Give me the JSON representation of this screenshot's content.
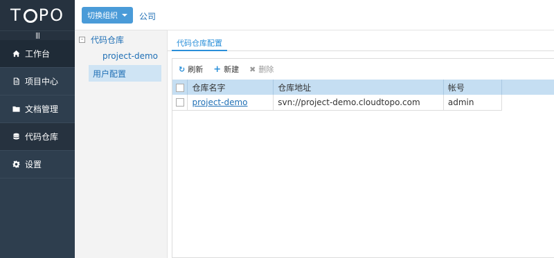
{
  "app": {
    "logo_text_left": "T",
    "logo_text_right": "PO",
    "collapse_icon": "|||"
  },
  "sidebar": {
    "items": [
      {
        "label": "工作台",
        "icon": "home-icon"
      },
      {
        "label": "项目中心",
        "icon": "document-icon"
      },
      {
        "label": "文档管理",
        "icon": "folder-icon"
      },
      {
        "label": "代码仓库",
        "icon": "database-icon"
      },
      {
        "label": "设置",
        "icon": "gear-icon"
      }
    ]
  },
  "header": {
    "switch_org_label": "切换组织",
    "company_label": "公司"
  },
  "tree": {
    "root_label": "代码仓库",
    "root_toggle": "-",
    "child_label": "project-demo",
    "user_config_label": "用户配置"
  },
  "main": {
    "tab_label": "代码仓库配置",
    "toolbar": {
      "refresh_label": "刷新",
      "new_label": "新建",
      "delete_label": "删除"
    },
    "table": {
      "columns": [
        "仓库名字",
        "仓库地址",
        "帐号"
      ],
      "rows": [
        {
          "name": "project-demo",
          "url": "svn://project-demo.cloudtopo.com",
          "account": "admin"
        }
      ]
    }
  },
  "colors": {
    "sidebar_bg": "#2e3e4e",
    "accent": "#2a8fd9",
    "table_header_bg": "#c5def2"
  }
}
